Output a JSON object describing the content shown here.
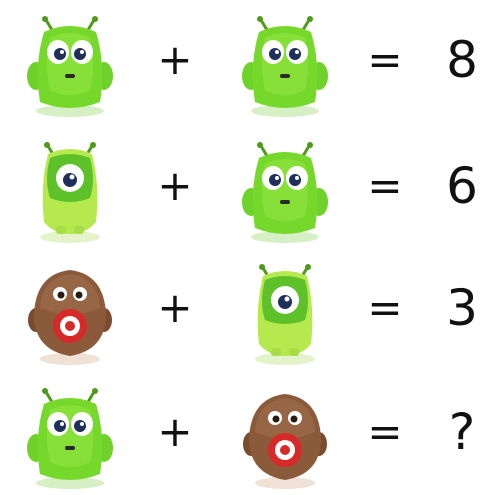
{
  "rows": [
    {
      "left": "two-eye-green-monster",
      "operator": "+",
      "right": "two-eye-green-monster",
      "equals": "=",
      "result": "8"
    },
    {
      "left": "one-eye-green-monster",
      "operator": "+",
      "right": "two-eye-green-monster",
      "equals": "=",
      "result": "6"
    },
    {
      "left": "brown-round-monster",
      "operator": "+",
      "right": "one-eye-green-monster",
      "equals": "=",
      "result": "3"
    },
    {
      "left": "two-eye-green-monster",
      "operator": "+",
      "right": "brown-round-monster",
      "equals": "=",
      "result": "?"
    }
  ],
  "colors": {
    "green_light": "#a6e64a",
    "green_dark": "#5fbf1f",
    "brown": "#8a5a3a",
    "red": "#d92c2c"
  }
}
